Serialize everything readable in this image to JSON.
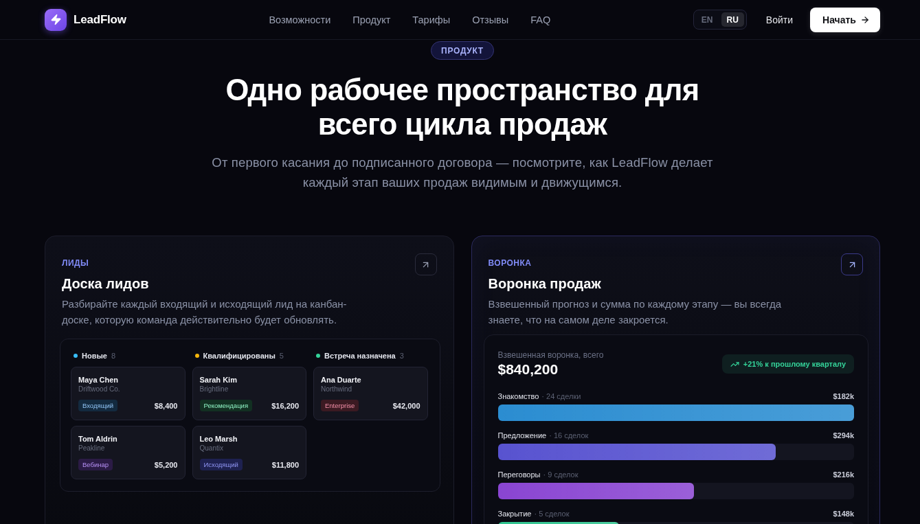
{
  "nav": {
    "brand": "LeadFlow",
    "links": [
      "Возможности",
      "Продукт",
      "Тарифы",
      "Отзывы",
      "FAQ"
    ],
    "languages": [
      {
        "label": "EN",
        "selected": false
      },
      {
        "label": "RU",
        "selected": true
      }
    ],
    "login": "Войти",
    "cta": "Начать"
  },
  "hero": {
    "badge": "ПРОДУКТ",
    "title": "Одно рабочее пространство для всего цикла продаж",
    "subtitle": "От первого касания до подписанного договора — посмотрите, как LeadFlow делает каждый этап ваших продаж видимым и движущимся."
  },
  "cards": [
    {
      "kind": "kanban",
      "highlighted": false,
      "eyebrow": "ЛИДЫ",
      "title": "Доска лидов",
      "description": "Разбирайте каждый входящий и исходящий лид на канбан-доске, которую команда действительно будет обновлять.",
      "columns": [
        {
          "name": "Новые",
          "count": "8",
          "color": "#38bdf8",
          "leads": [
            {
              "name": "Maya Chen",
              "company": "Driftwood Co.",
              "tag": {
                "label": "Входящий",
                "color": "#132a3f"
              },
              "amount": "$8,400"
            },
            {
              "name": "Tom Aldrin",
              "company": "Peakline",
              "tag": {
                "label": "Вебинар",
                "color": "#2b1b45"
              },
              "amount": "$5,200"
            }
          ]
        },
        {
          "name": "Квалифицированы",
          "count": "5",
          "color": "#f5b60b",
          "leads": [
            {
              "name": "Sarah Kim",
              "company": "Brightline",
              "tag": {
                "label": "Рекомендация",
                "color": "#123022"
              },
              "amount": "$16,200"
            },
            {
              "name": "Leo Marsh",
              "company": "Quantix",
              "tag": {
                "label": "Исходящий",
                "color": "#1e2150"
              },
              "amount": "$11,800"
            }
          ]
        },
        {
          "name": "Встреча назначена",
          "count": "3",
          "color": "#34d399",
          "leads": [
            {
              "name": "Ana Duarte",
              "company": "Northwind",
              "tag": {
                "label": "Enterprise",
                "color": "#3b1a22"
              },
              "amount": "$42,000"
            }
          ]
        }
      ]
    },
    {
      "kind": "funnel",
      "highlighted": true,
      "eyebrow": "ВОРОНКА",
      "title": "Воронка продаж",
      "description": "Взвешенный прогноз и сумма по каждому этапу — вы всегда знаете, что на самом деле закроется.",
      "total_label": "Взвешенная воронка, всего",
      "total": "$840,200",
      "trend": "+21% к прошлому кварталу",
      "stages": [
        {
          "name": "Знакомство",
          "deals": "· 24 сделки",
          "value": "$182k",
          "level": 1,
          "color": "#2b8dd1"
        },
        {
          "name": "Предложение",
          "deals": "· 16 сделок",
          "value": "$294k",
          "level": 0.78,
          "color": "#5853d0"
        },
        {
          "name": "Переговоры",
          "deals": "· 9 сделок",
          "value": "$216k",
          "level": 0.55,
          "color": "#8a45d2"
        },
        {
          "name": "Закрытие",
          "deals": "· 5 сделок",
          "value": "$148k",
          "level": 0.34,
          "color": "#2fc48f"
        }
      ]
    }
  ]
}
